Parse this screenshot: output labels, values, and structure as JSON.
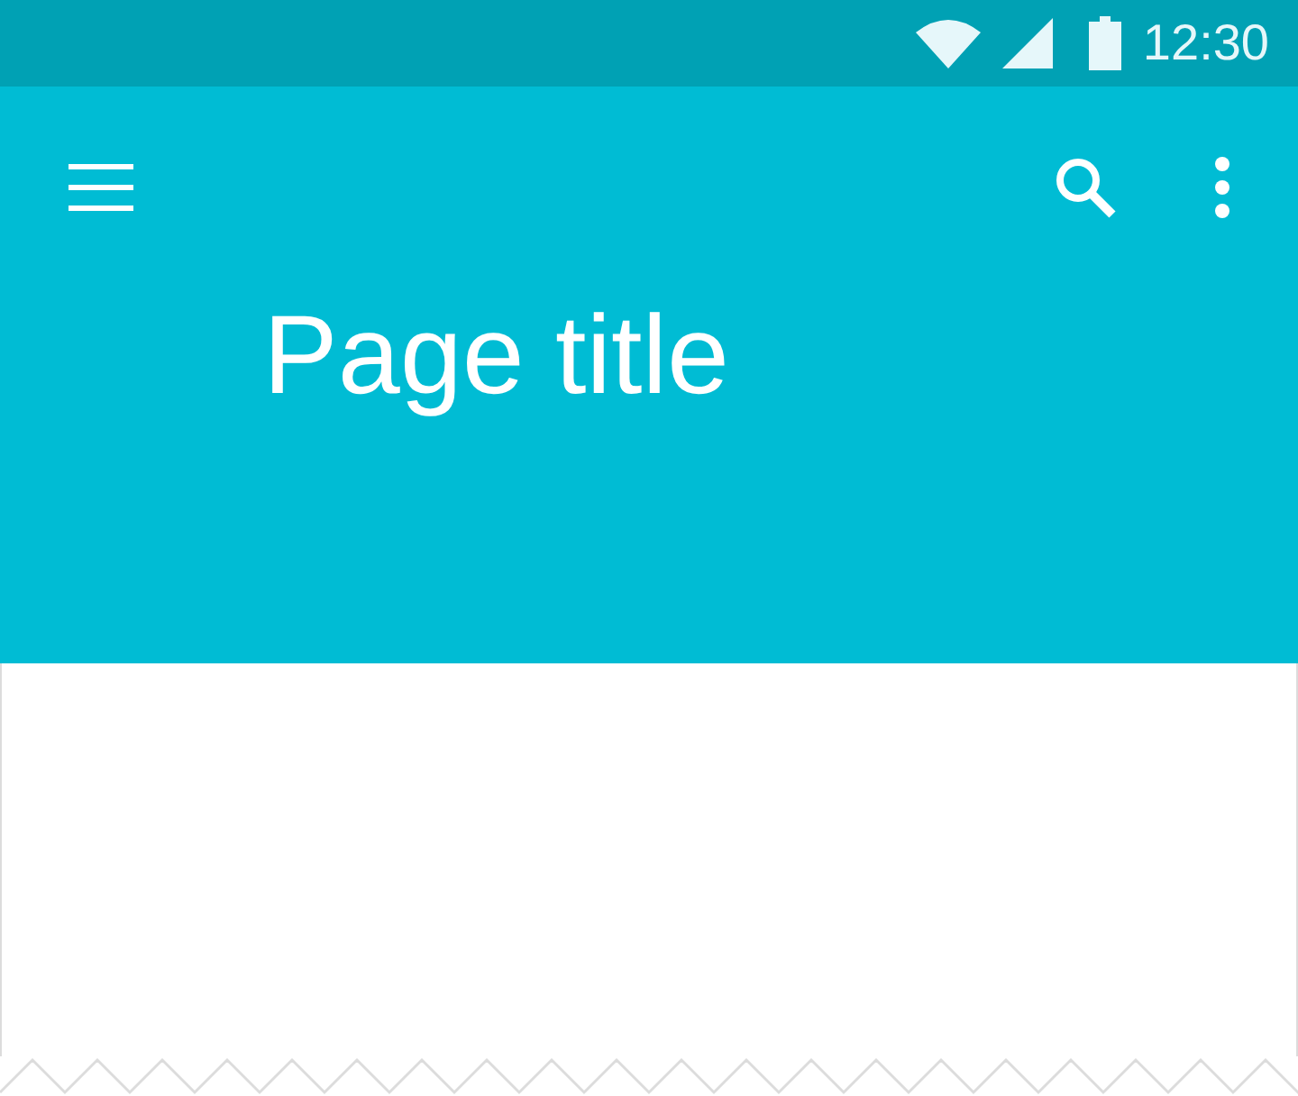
{
  "status_bar": {
    "time": "12:30"
  },
  "app_bar": {
    "title": "Page title"
  }
}
